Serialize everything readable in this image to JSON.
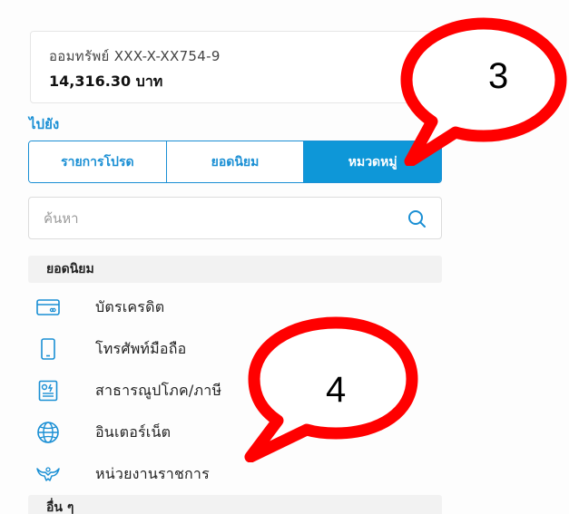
{
  "account": {
    "name": "ออมทรัพย์ XXX-X-XX754-9",
    "balance": "14,316.30 บาท"
  },
  "goto_label": "ไปยัง",
  "tabs": [
    {
      "label": "รายการโปรด",
      "active": false
    },
    {
      "label": "ยอดนิยม",
      "active": false
    },
    {
      "label": "หมวดหมู่",
      "active": true
    }
  ],
  "search": {
    "placeholder": "ค้นหา",
    "icon": "search-icon"
  },
  "sections": {
    "popular": "ยอดนิยม",
    "others": "อื่น ๆ"
  },
  "list_items": [
    {
      "label": "บัตรเครดิต",
      "icon": "credit-card-icon"
    },
    {
      "label": "โทรศัพท์มือถือ",
      "icon": "mobile-phone-icon"
    },
    {
      "label": "สาธารณูปโภค/ภาษี",
      "icon": "utility-bill-icon"
    },
    {
      "label": "อินเตอร์เน็ต",
      "icon": "globe-icon"
    },
    {
      "label": "หน่วยงานราชการ",
      "icon": "garuda-icon"
    }
  ],
  "callouts": [
    {
      "number": "3"
    },
    {
      "number": "4"
    }
  ],
  "colors": {
    "accent": "#1a8fd4",
    "active_tab": "#0e97d8",
    "callout_red": "#ff0000"
  }
}
